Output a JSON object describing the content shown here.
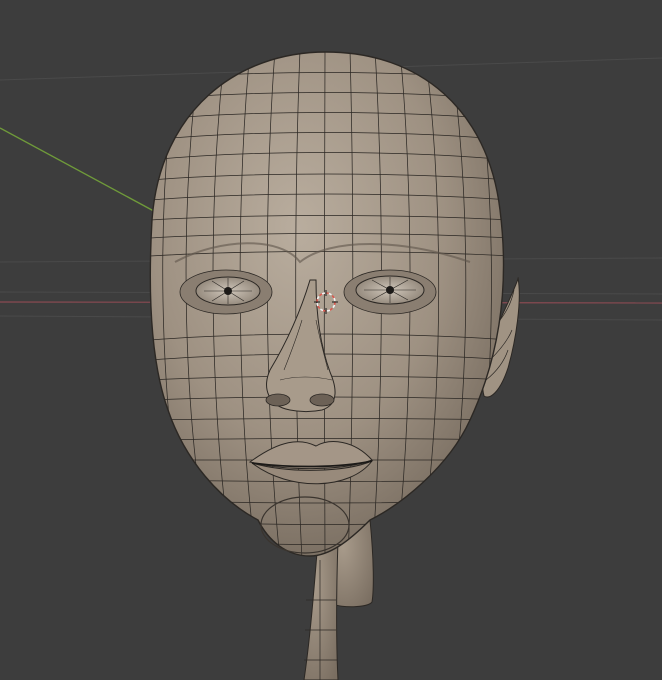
{
  "viewport": {
    "background_color": "#3d3d3d",
    "grid_color": "#4a4a4a",
    "x_axis_color": "#8a4a52",
    "y_axis_color": "#6f9a3a",
    "cursor_color": "#d9584e",
    "object": {
      "type": "head-mesh",
      "mode": "wireframe-overlay",
      "surface_color": "#9e9182",
      "wire_color": "#2c2824"
    }
  }
}
